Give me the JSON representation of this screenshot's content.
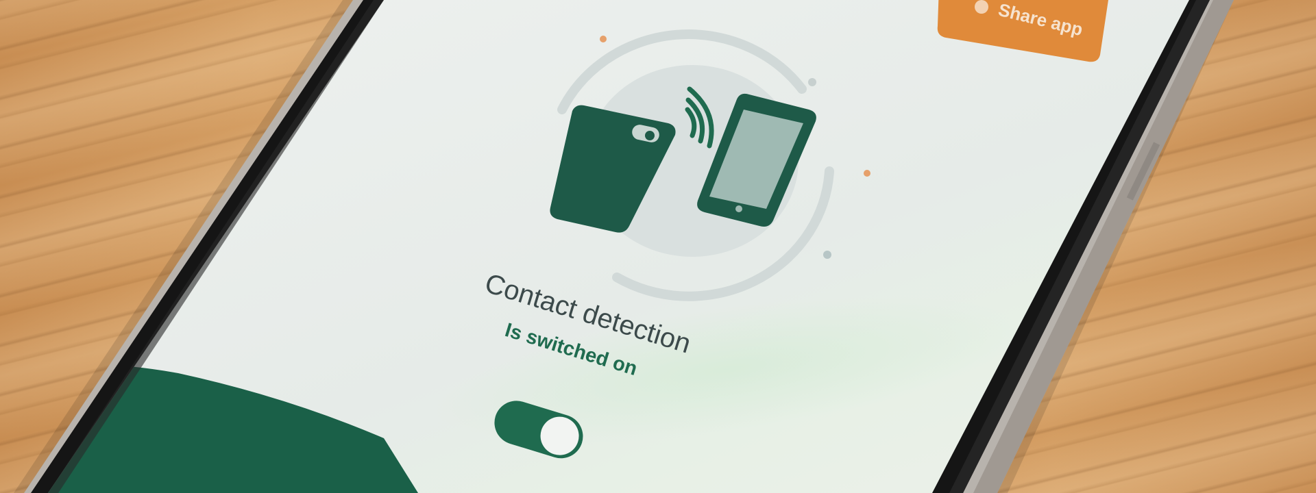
{
  "share_button": {
    "label": "Share app",
    "color": "#e08a3a"
  },
  "status": {
    "title": "Contact detection",
    "subtitle": "Is switched on",
    "toggle_on": true
  },
  "colors": {
    "accent_green": "#1f6b4f",
    "dark_green": "#1e5a48",
    "screen_bg": "#e8ecea",
    "orange": "#e08a3a"
  },
  "icons": [
    "share-icon",
    "phone-back-icon",
    "phone-front-icon",
    "wireless-signal-icon"
  ]
}
